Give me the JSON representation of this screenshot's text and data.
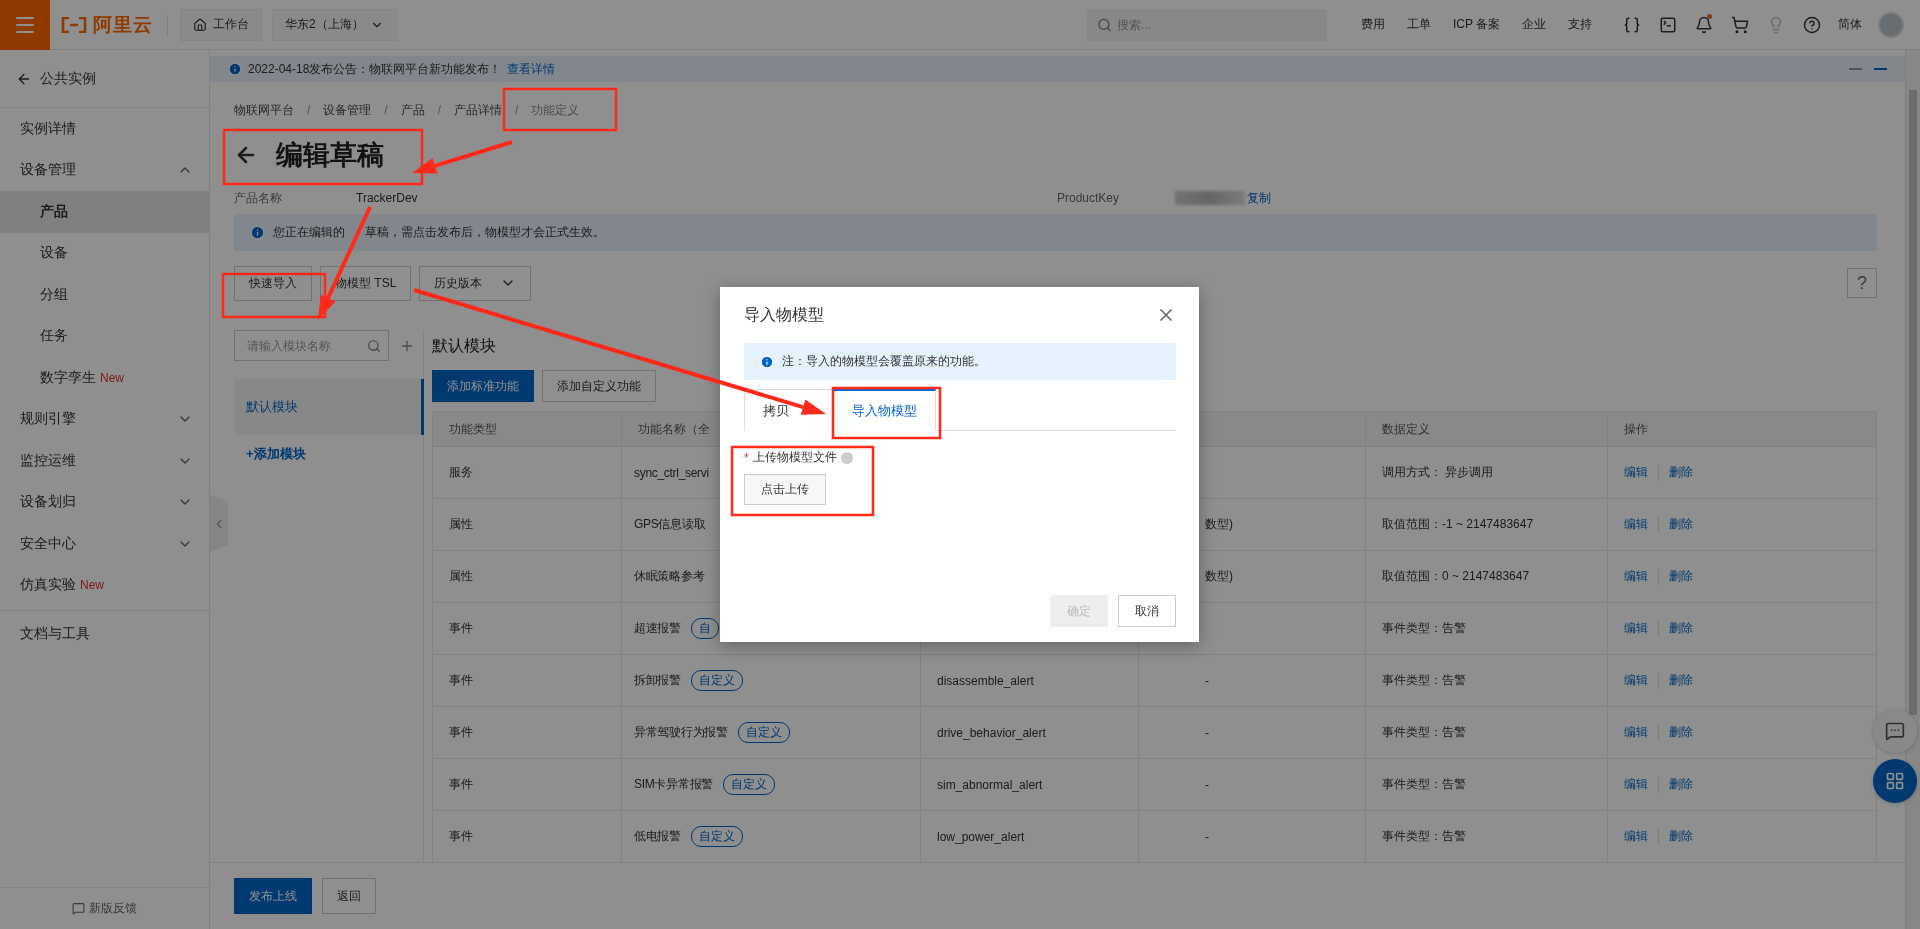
{
  "top_bar": {
    "logo_text": "阿里云",
    "workbench": "工作台",
    "region": "华东2（上海）",
    "search_placeholder": "搜索...",
    "links": [
      "费用",
      "工单",
      "ICP 备案",
      "企业",
      "支持"
    ],
    "bell_dot": true,
    "language": "简体"
  },
  "sidebar": {
    "back_label": "公共实例",
    "items": [
      {
        "label": "实例详情",
        "kind": "link",
        "selected": false
      },
      {
        "label": "设备管理",
        "kind": "group",
        "expanded": true,
        "selected": false,
        "children": [
          {
            "label": "产品",
            "selected": true
          },
          {
            "label": "设备",
            "selected": false
          },
          {
            "label": "分组",
            "selected": false
          },
          {
            "label": "任务",
            "selected": false
          },
          {
            "label": "数字孪生",
            "badge": "New",
            "selected": false
          }
        ]
      },
      {
        "label": "规则引擎",
        "kind": "group",
        "expanded": false,
        "selected": false
      },
      {
        "label": "监控运维",
        "kind": "group",
        "expanded": false,
        "selected": false
      },
      {
        "label": "设备划归",
        "kind": "group",
        "expanded": false,
        "selected": false
      },
      {
        "label": "安全中心",
        "kind": "group",
        "expanded": false,
        "selected": false
      },
      {
        "label": "仿真实验",
        "kind": "link",
        "badge": "New",
        "selected": false
      }
    ],
    "footer_items": [
      {
        "label": "文档与工具",
        "selected": false
      }
    ],
    "feedback": "新版反馈"
  },
  "announcement": {
    "text": "2022-04-18发布公告：物联网平台新功能发布！",
    "link": "查看详情"
  },
  "breadcrumb": {
    "separator": "/",
    "items": [
      "物联网平台",
      "设备管理",
      "产品",
      "产品详情",
      "功能定义"
    ]
  },
  "page": {
    "title": "编辑草稿",
    "fields": [
      {
        "label": "产品名称",
        "kind": "text",
        "value": "TrackerDev"
      },
      {
        "label": "ProductKey",
        "kind": "masked",
        "action": "复制"
      }
    ],
    "info": [
      "您正在编辑的",
      "草稿，需点击发布后，物模型才会正式生效。"
    ]
  },
  "toolbar": {
    "buttons": [
      "快速导入",
      "物模型 TSL"
    ],
    "history": "历史版本",
    "help": "?"
  },
  "modules": {
    "search_placeholder": "请输入模块名称",
    "items": [
      {
        "label": "默认模块",
        "selected": true
      }
    ],
    "add": "+添加模块"
  },
  "panel": {
    "title": "默认模块",
    "actions": [
      {
        "label": "添加标准功能",
        "kind": "primary"
      },
      {
        "label": "添加自定义功能",
        "kind": "default"
      }
    ]
  },
  "table": {
    "columns": {
      "type": "功能类型",
      "name": "功能名称（全",
      "definition": "数据定义",
      "actions": "操作"
    },
    "rows": [
      {
        "type": "服务",
        "name": "sync_ctrl_servi",
        "definition": "调用方式： 异步调用",
        "actions": [
          "编辑",
          "删除"
        ]
      },
      {
        "type": "属性",
        "name": "GPS信息读取",
        "data_type": "数型)",
        "definition": "取值范围：-1 ~ 2147483647",
        "actions": [
          "编辑",
          "删除"
        ]
      },
      {
        "type": "属性",
        "name": "休眠策略参考",
        "data_type": "数型)",
        "definition": "取值范围：0 ~ 2147483647",
        "actions": [
          "编辑",
          "删除"
        ]
      },
      {
        "type": "事件",
        "name": "超速报警",
        "badge": "自",
        "definition": "事件类型：告警",
        "actions": [
          "编辑",
          "删除"
        ]
      },
      {
        "type": "事件",
        "name": "拆卸报警",
        "badge": "自定义",
        "identifier": "disassemble_alert",
        "data_type": "-",
        "definition": "事件类型：告警",
        "actions": [
          "编辑",
          "删除"
        ]
      },
      {
        "type": "事件",
        "name": "异常驾驶行为报警",
        "badge": "自定义",
        "identifier": "drive_behavior_alert",
        "data_type": "-",
        "definition": "事件类型：告警",
        "actions": [
          "编辑",
          "删除"
        ]
      },
      {
        "type": "事件",
        "name": "SIM卡异常报警",
        "badge": "自定义",
        "identifier": "sim_abnormal_alert",
        "data_type": "-",
        "definition": "事件类型：告警",
        "actions": [
          "编辑",
          "删除"
        ]
      },
      {
        "type": "事件",
        "name": "低电报警",
        "badge": "自定义",
        "identifier": "low_power_alert",
        "data_type": "-",
        "definition": "事件类型：告警",
        "actions": [
          "编辑",
          "删除"
        ]
      }
    ]
  },
  "footer": {
    "buttons": [
      {
        "label": "发布上线",
        "kind": "primary"
      },
      {
        "label": "返回",
        "kind": "default"
      }
    ]
  },
  "dialog": {
    "title": "导入物模型",
    "notice": "注：导入的物模型会覆盖原来的功能。",
    "tabs": [
      {
        "label": "拷贝",
        "selected": false
      },
      {
        "label": "导入物模型",
        "selected": true
      }
    ],
    "field_label": "上传物模型文件",
    "required_mark": "*",
    "upload": "点击上传",
    "buttons": [
      {
        "label": "确定",
        "kind": "primary",
        "disabled": true
      },
      {
        "label": "取消",
        "kind": "default",
        "disabled": false
      }
    ]
  }
}
